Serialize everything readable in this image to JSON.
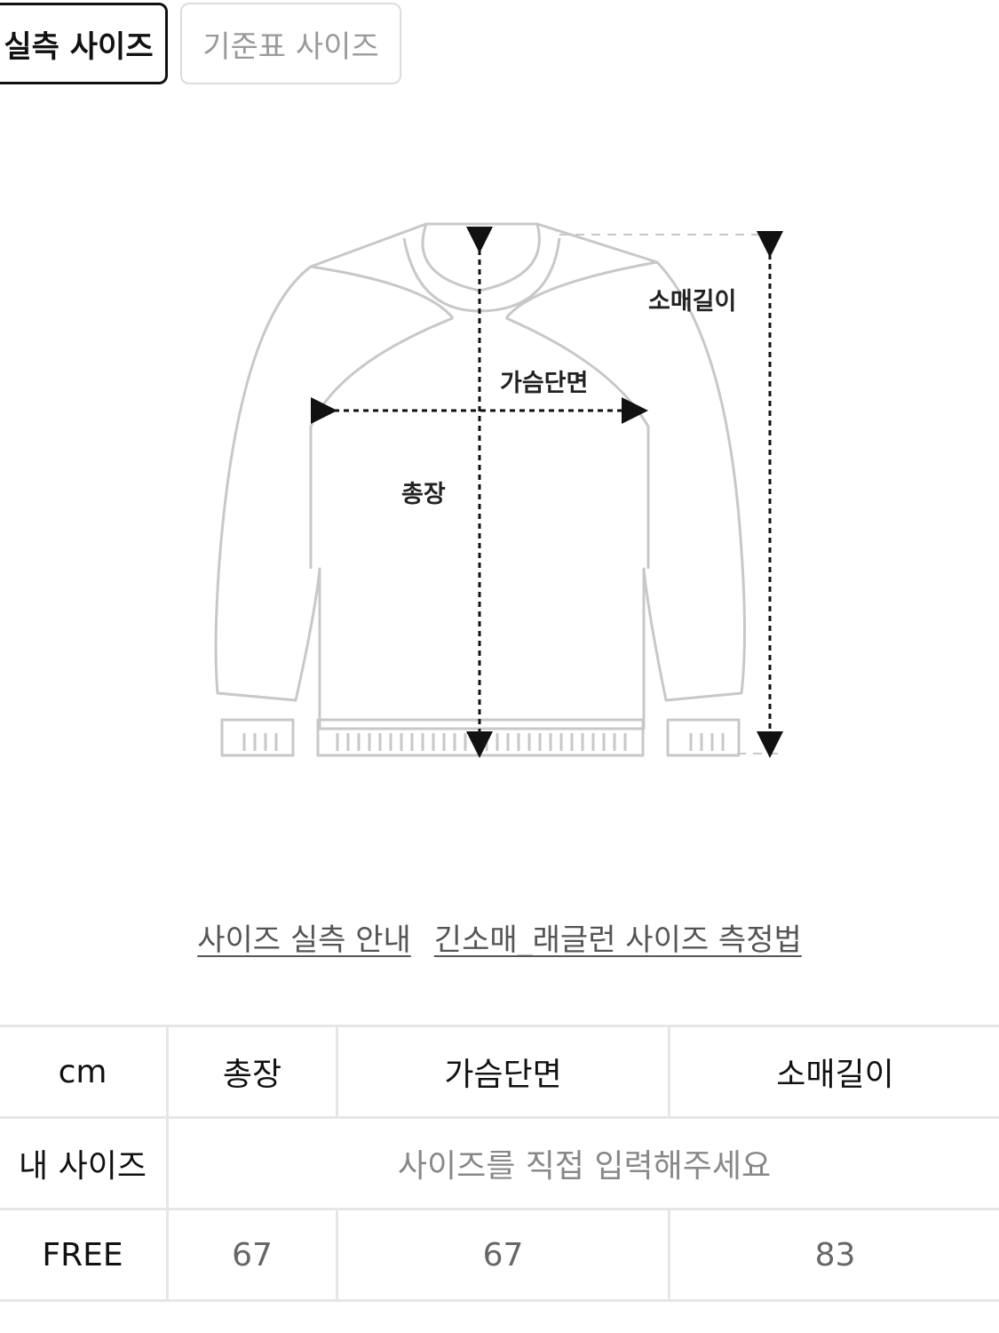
{
  "tabs": {
    "actual": "실측 사이즈",
    "standard": "기준표 사이즈"
  },
  "diagram": {
    "sleeve_label": "소매길이",
    "chest_label": "가슴단면",
    "length_label": "총장"
  },
  "links": {
    "guide": "사이즈 실측 안내",
    "method": "긴소매_래글런 사이즈 측정법"
  },
  "table": {
    "unit": "cm",
    "headers": [
      "총장",
      "가슴단면",
      "소매길이"
    ],
    "my_size_label": "내 사이즈",
    "my_size_placeholder": "사이즈를 직접 입력해주세요",
    "rows": [
      {
        "size": "FREE",
        "values": [
          "67",
          "67",
          "83"
        ]
      }
    ]
  }
}
